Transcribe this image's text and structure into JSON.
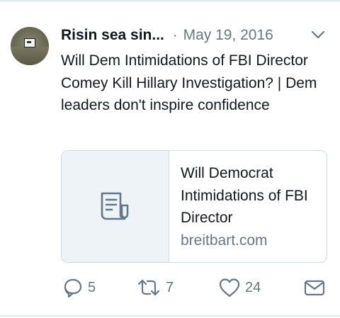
{
  "tweet": {
    "author_name": "Risin sea sin...",
    "separator": "·",
    "date": "May 19, 2016",
    "text": "Will Dem Intimidations of FBI Director Comey Kill Hillary Investigation? | Dem leaders don't inspire confidence"
  },
  "card": {
    "title": "Will Democrat Intimidations of FBI Director",
    "domain": "breitbart.com",
    "thumbnail_icon": "document-icon"
  },
  "actions": {
    "reply_count": "5",
    "retweet_count": "7",
    "like_count": "24"
  },
  "colors": {
    "text_primary": "#14171a",
    "text_secondary": "#657786",
    "border": "#d3dbe0",
    "thumb_bg": "#eef3f7"
  }
}
